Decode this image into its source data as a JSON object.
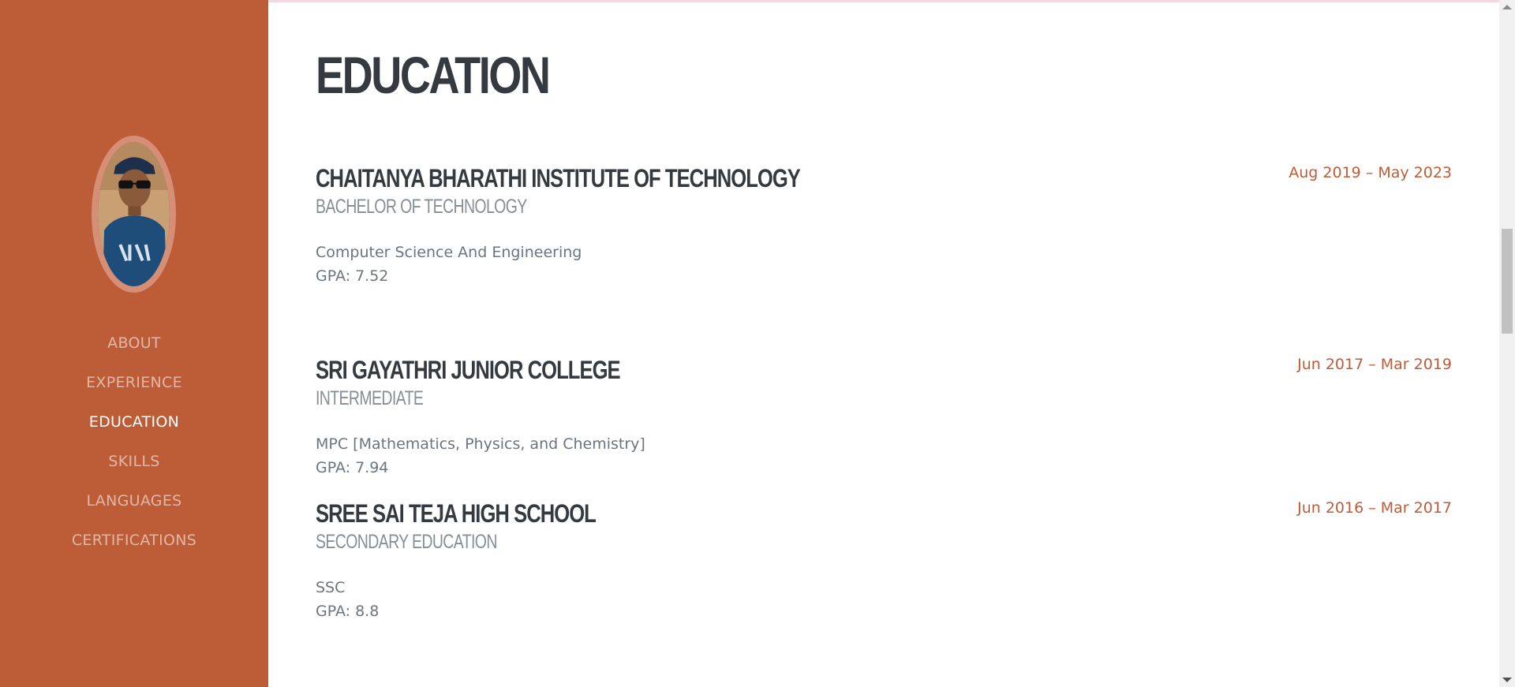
{
  "nav": {
    "items": [
      {
        "label": "ABOUT"
      },
      {
        "label": "EXPERIENCE"
      },
      {
        "label": "EDUCATION"
      },
      {
        "label": "SKILLS"
      },
      {
        "label": "LANGUAGES"
      },
      {
        "label": "CERTIFICATIONS"
      }
    ],
    "active": "EDUCATION"
  },
  "section": {
    "title": "EDUCATION"
  },
  "education": [
    {
      "school": "CHAITANYA BHARATHI INSTITUTE OF TECHNOLOGY",
      "degree": "BACHELOR OF TECHNOLOGY",
      "field": "Computer Science And Engineering",
      "gpa": "GPA: 7.52",
      "date": "Aug 2019 – May 2023"
    },
    {
      "school": "SRI GAYATHRI JUNIOR COLLEGE",
      "degree": "INTERMEDIATE",
      "field": "MPC [Mathematics, Physics, and Chemistry]",
      "gpa": "GPA: 7.94",
      "date": "Jun 2017 – Mar 2019"
    },
    {
      "school": "SREE SAI TEJA HIGH SCHOOL",
      "degree": "SECONDARY EDUCATION",
      "field": "SSC",
      "gpa": "GPA: 8.8",
      "date": "Jun 2016 – Mar 2017"
    }
  ],
  "colors": {
    "sidebar": "#bd5d38",
    "heading": "#343a40",
    "subheading": "#868e96",
    "body_text": "#6c757d",
    "accent": "#bd5d38"
  }
}
